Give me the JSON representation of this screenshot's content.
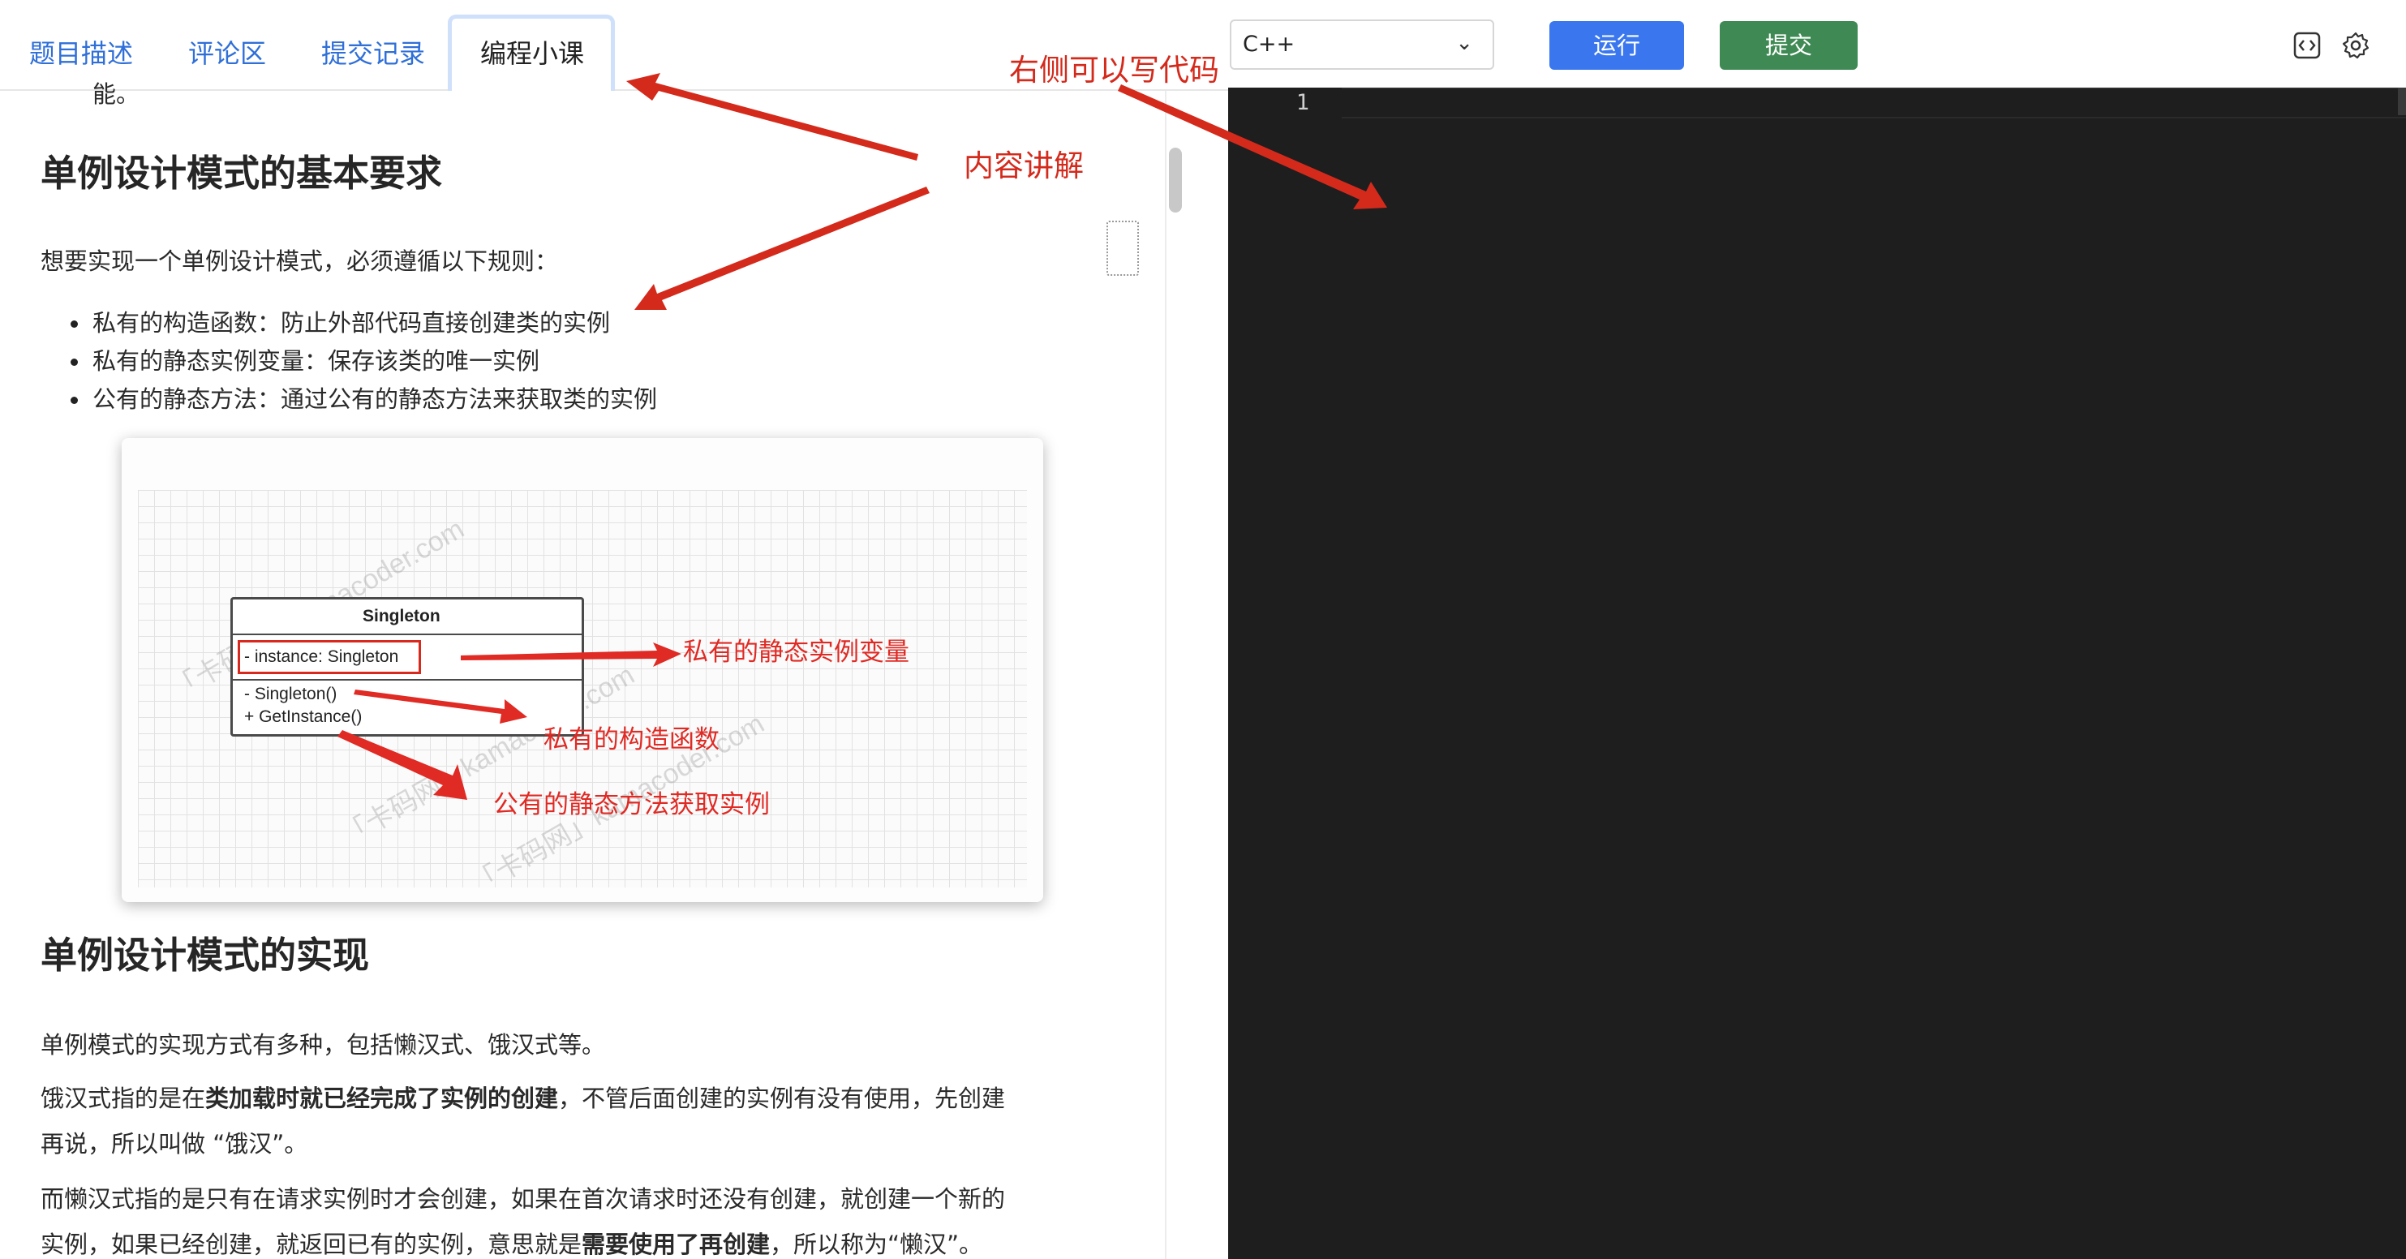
{
  "tabs": [
    {
      "label": "题目描述"
    },
    {
      "label": "评论区"
    },
    {
      "label": "提交记录"
    },
    {
      "label": "编程小课"
    }
  ],
  "article": {
    "partial_line": "能。",
    "h_requirements": "单例设计模式的基本要求",
    "intro": "想要实现一个单例设计模式，必须遵循以下规则：",
    "bullets": [
      "私有的构造函数：防止外部代码直接创建类的实例",
      "私有的静态实例变量：保存该类的唯一实例",
      "公有的静态方法：通过公有的静态方法来获取类的实例"
    ],
    "h_impl": "单例设计模式的实现",
    "p1": "单例模式的实现方式有多种，包括懒汉式、饿汉式等。",
    "p2_a": "饿汉式指的是在",
    "p2_b": "类加载时就已经完成了实例的创建",
    "p2_c": "，不管后面创建的实例有没有使用，先创建",
    "p2_line2": "再说，所以叫做 “饿汉”。",
    "p3_line1": "而懒汉式指的是只有在请求实例时才会创建，如果在首次请求时还没有创建，就创建一个新的",
    "p3_a": "实例，如果已经创建，就返回已有的实例，意思就是",
    "p3_b": "需要使用了再创建",
    "p3_c": "，所以称为“懒汉”。"
  },
  "figure": {
    "uml_title": "Singleton",
    "uml_field": "- instance: Singleton",
    "uml_method1": "-  Singleton()",
    "uml_method2": "+ GetInstance()",
    "label_field": "私有的静态实例变量",
    "label_ctor": "私有的构造函数",
    "label_method": "公有的静态方法获取实例",
    "watermark": "「卡码网」kamacoder.com"
  },
  "toolbar": {
    "language": "C++",
    "run_label": "运行",
    "submit_label": "提交"
  },
  "editor": {
    "line_number": "1"
  },
  "callouts": {
    "content": "内容讲解",
    "code": "右侧可以写代码"
  },
  "colors": {
    "tab_link": "#2f6fd8",
    "run_button": "#3a77ef",
    "submit_button": "#3f8a54",
    "editor_bg": "#1e1e1e",
    "annotation_red": "#d42a1c"
  }
}
